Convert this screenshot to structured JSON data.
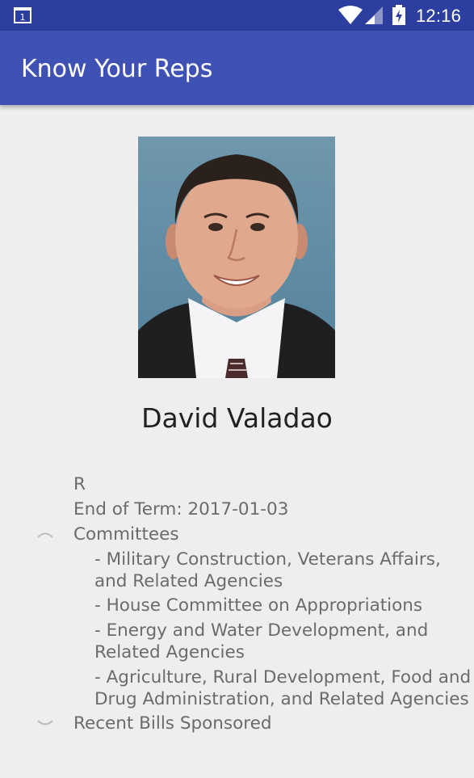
{
  "status_bar": {
    "time": "12:16",
    "icons": [
      "notification-icon",
      "wifi-icon",
      "signal-icon",
      "battery-charging-icon"
    ]
  },
  "app_bar": {
    "title": "Know Your Reps"
  },
  "representative": {
    "name": "David Valadao",
    "party": "R",
    "end_of_term": "End of Term: 2017-01-03",
    "committees_label": "Committees",
    "committees": [
      {
        "line1": "- Military Construction, Veterans Affairs,",
        "line2": "and Related Agencies"
      },
      {
        "line1": "- House Committee on Appropriations"
      },
      {
        "line1": "- Energy and Water Development, and",
        "line2": "Related Agencies"
      },
      {
        "line1": "- Agriculture, Rural Development, Food and",
        "line2": "Drug Administration, and Related Agencies"
      }
    ],
    "bills_label": "Recent Bills Sponsored"
  },
  "colors": {
    "status_bar": "#2c3e9f",
    "app_bar": "#3f51b5",
    "background": "#eeeeee",
    "text_secondary": "#6b6b6b",
    "text_primary": "#212121"
  }
}
